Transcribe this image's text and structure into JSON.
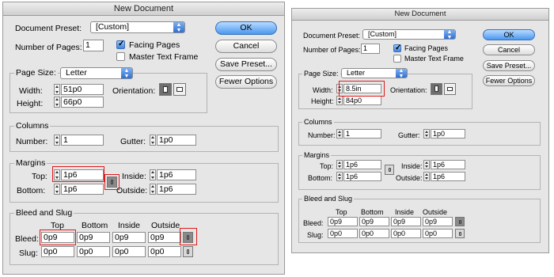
{
  "dialog_left": {
    "title": "New Document",
    "document_preset_label": "Document Preset:",
    "document_preset_value": "[Custom]",
    "number_of_pages_label": "Number of Pages:",
    "number_of_pages_value": "1",
    "facing_pages_label": "Facing Pages",
    "master_text_frame_label": "Master Text Frame",
    "buttons": {
      "ok": "OK",
      "cancel": "Cancel",
      "save_preset": "Save Preset...",
      "fewer_options": "Fewer Options"
    },
    "page_size_label": "Page Size:",
    "page_size_value": "Letter",
    "width_label": "Width:",
    "width_value": "51p0",
    "height_label": "Height:",
    "height_value": "66p0",
    "orientation_label": "Orientation:",
    "columns": {
      "title": "Columns",
      "number_label": "Number:",
      "number_value": "1",
      "gutter_label": "Gutter:",
      "gutter_value": "1p0"
    },
    "margins": {
      "title": "Margins",
      "top_label": "Top:",
      "top_value": "1p6",
      "bottom_label": "Bottom:",
      "bottom_value": "1p6",
      "inside_label": "Inside:",
      "inside_value": "1p6",
      "outside_label": "Outside:",
      "outside_value": "1p6"
    },
    "bleed": {
      "title": "Bleed and Slug",
      "headers": [
        "Top",
        "Bottom",
        "Inside",
        "Outside"
      ],
      "bleed_label": "Bleed:",
      "bleed_values": [
        "0p9",
        "0p9",
        "0p9",
        "0p9"
      ],
      "slug_label": "Slug:",
      "slug_values": [
        "0p0",
        "0p0",
        "0p0",
        "0p0"
      ]
    }
  },
  "dialog_right": {
    "title": "New Document",
    "document_preset_label": "Document Preset:",
    "document_preset_value": "[Custom]",
    "number_of_pages_label": "Number of Pages:",
    "number_of_pages_value": "1",
    "facing_pages_label": "Facing Pages",
    "master_text_frame_label": "Master Text Frame",
    "buttons": {
      "ok": "OK",
      "cancel": "Cancel",
      "save_preset": "Save Preset...",
      "fewer_options": "Fewer Options"
    },
    "page_size_label": "Page Size:",
    "page_size_value": "Letter",
    "width_label": "Width:",
    "width_value": "8.5in",
    "height_label": "Height:",
    "height_value": "84p0",
    "orientation_label": "Orientation:",
    "columns": {
      "title": "Columns",
      "number_label": "Number:",
      "number_value": "1",
      "gutter_label": "Gutter:",
      "gutter_value": "1p0"
    },
    "margins": {
      "title": "Margins",
      "top_label": "Top:",
      "top_value": "1p6",
      "bottom_label": "Bottom:",
      "bottom_value": "1p6",
      "inside_label": "Inside:",
      "inside_value": "1p6",
      "outside_label": "Outside:",
      "outside_value": "1p6"
    },
    "bleed": {
      "title": "Bleed and Slug",
      "headers": [
        "Top",
        "Bottom",
        "Inside",
        "Outside"
      ],
      "bleed_label": "Bleed:",
      "bleed_values": [
        "0p9",
        "0p9",
        "0p9",
        "0p9"
      ],
      "slug_label": "Slug:",
      "slug_values": [
        "0p0",
        "0p0",
        "0p0",
        "0p0"
      ]
    }
  },
  "colors": {
    "highlight": "#e0191b",
    "dialog_bg": "#e6e6e6",
    "accent_blue": "#4b98f0"
  },
  "icons": [
    "select-arrow-icon",
    "spinner-icon",
    "checkmark-icon",
    "portrait-orientation-icon",
    "landscape-orientation-icon",
    "chain-link-icon"
  ]
}
